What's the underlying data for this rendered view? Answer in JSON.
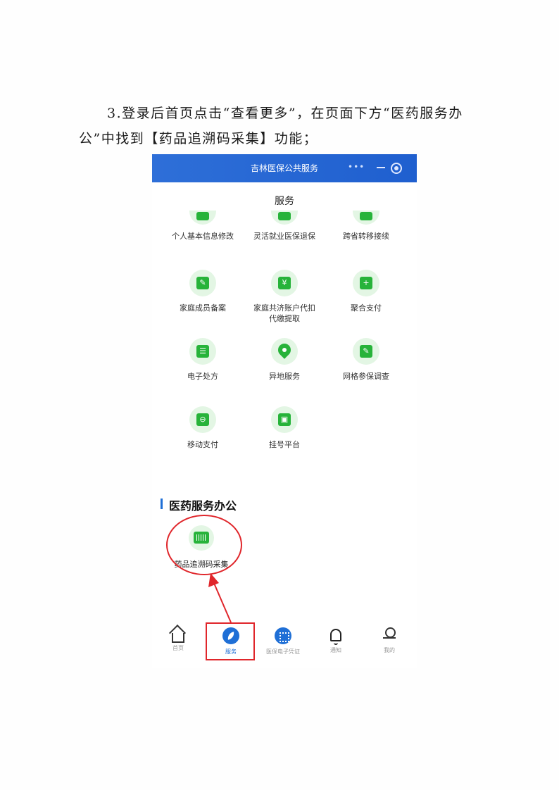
{
  "instruction": {
    "line1": "3.登录后首页点击“查看更多”，在页面下方“医药服务办",
    "line2": "公”中找到【药品追溯码采集】功能；"
  },
  "app": {
    "title": "吉林医保公共服务",
    "capsule_dots": "•••"
  },
  "services": {
    "title": "服务",
    "items": [
      {
        "label": "个人基本信息修改",
        "icon": "id-card-icon"
      },
      {
        "label": "灵活就业医保退保",
        "icon": "refund-icon"
      },
      {
        "label": "跨省转移接续",
        "icon": "transfer-icon"
      },
      {
        "label": "家庭成员备案",
        "icon": "edit-pen-icon"
      },
      {
        "label": "家庭共济账户代扣",
        "label2": "代缴提取",
        "icon": "wallet-icon"
      },
      {
        "label": "聚合支付",
        "icon": "payment-icon"
      },
      {
        "label": "电子处方",
        "icon": "prescription-icon"
      },
      {
        "label": "异地服务",
        "icon": "location-pin-icon"
      },
      {
        "label": "网格参保调查",
        "icon": "edit-pen-icon"
      },
      {
        "label": "移动支付",
        "icon": "mobile-pay-icon"
      },
      {
        "label": "挂号平台",
        "icon": "registration-icon"
      }
    ]
  },
  "medical_office": {
    "title": "医药服务办公",
    "item_label": "药品追溯码采集"
  },
  "tabbar": {
    "items": [
      "首页",
      "服务",
      "医保电子凭证",
      "通知",
      "我的"
    ]
  },
  "colors": {
    "header_blue": "#2e6fd8",
    "icon_green": "#27b33a",
    "highlight_red": "#e0262b",
    "active_blue": "#1f6fd6"
  }
}
